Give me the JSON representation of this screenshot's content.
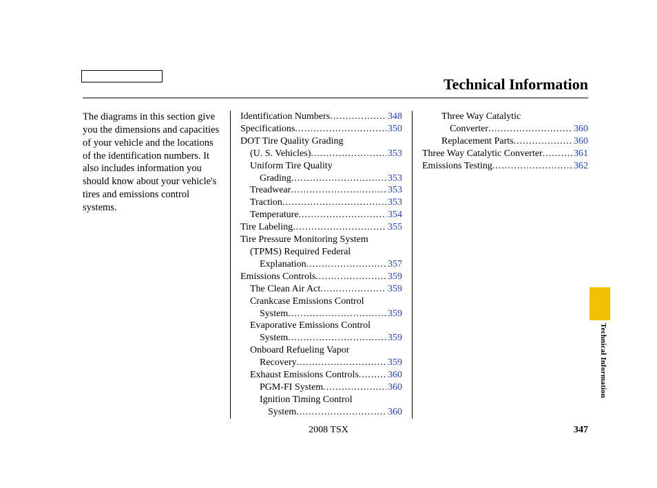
{
  "header": {
    "title": "Technical Information"
  },
  "intro": "The diagrams in this section give you the dimensions and capacities of your vehicle and the locations of the identification numbers. It also includes information you should know about your vehicle's tires and emissions control systems.",
  "toc_col2": [
    {
      "label": "Identification Numbers",
      "page": "348",
      "indent": 0
    },
    {
      "label": "Specifications",
      "page": "350",
      "indent": 0
    },
    {
      "label": "DOT Tire Quality Grading",
      "page": "",
      "indent": 0,
      "nodots": true
    },
    {
      "label": "(U. S. Vehicles)",
      "page": "353",
      "indent": 1
    },
    {
      "label": "Uniform Tire Quality",
      "page": "",
      "indent": 1,
      "nodots": true
    },
    {
      "label": "Grading",
      "page": "353",
      "indent": 2
    },
    {
      "label": "Treadwear",
      "page": "353",
      "indent": 1
    },
    {
      "label": "Traction",
      "page": "353",
      "indent": 1
    },
    {
      "label": "Temperature",
      "page": "354",
      "indent": 1
    },
    {
      "label": "Tire Labeling",
      "page": "355",
      "indent": 0
    },
    {
      "label": "Tire Pressure Monitoring System",
      "page": "",
      "indent": 0,
      "nodots": true
    },
    {
      "label": "(TPMS)    Required Federal",
      "page": "",
      "indent": 1,
      "nodots": true
    },
    {
      "label": "Explanation",
      "page": "357",
      "indent": 2
    },
    {
      "label": "Emissions Controls",
      "page": "359",
      "indent": 0
    },
    {
      "label": "The Clean Air Act",
      "page": "359",
      "indent": 1
    },
    {
      "label": "Crankcase Emissions Control",
      "page": "",
      "indent": 1,
      "nodots": true
    },
    {
      "label": "System",
      "page": "359",
      "indent": 2
    },
    {
      "label": "Evaporative Emissions Control",
      "page": "",
      "indent": 1,
      "nodots": true
    },
    {
      "label": "System",
      "page": "359",
      "indent": 2
    },
    {
      "label": "Onboard Refueling Vapor",
      "page": "",
      "indent": 1,
      "nodots": true
    },
    {
      "label": "Recovery",
      "page": "359",
      "indent": 2
    },
    {
      "label": "Exhaust Emissions Controls",
      "page": "360",
      "indent": 1
    },
    {
      "label": "PGM-FI System",
      "page": "360",
      "indent": 2
    },
    {
      "label": "Ignition Timing Control",
      "page": "",
      "indent": 2,
      "nodots": true
    },
    {
      "label": "System",
      "page": "360",
      "indent": 2,
      "extraindent": true
    }
  ],
  "toc_col3": [
    {
      "label": "Three Way Catalytic",
      "page": "",
      "indent": 2,
      "nodots": true
    },
    {
      "label": "Converter",
      "page": "360",
      "indent": 2,
      "extraindent": true
    },
    {
      "label": "Replacement Parts",
      "page": "360",
      "indent": 2
    },
    {
      "label": "Three Way Catalytic Converter",
      "page": "361",
      "indent": 0
    },
    {
      "label": "Emissions Testing",
      "page": "362",
      "indent": 0
    }
  ],
  "footer": {
    "model": "2008  TSX",
    "page_number": "347"
  },
  "side": {
    "label": "Technical Information"
  }
}
